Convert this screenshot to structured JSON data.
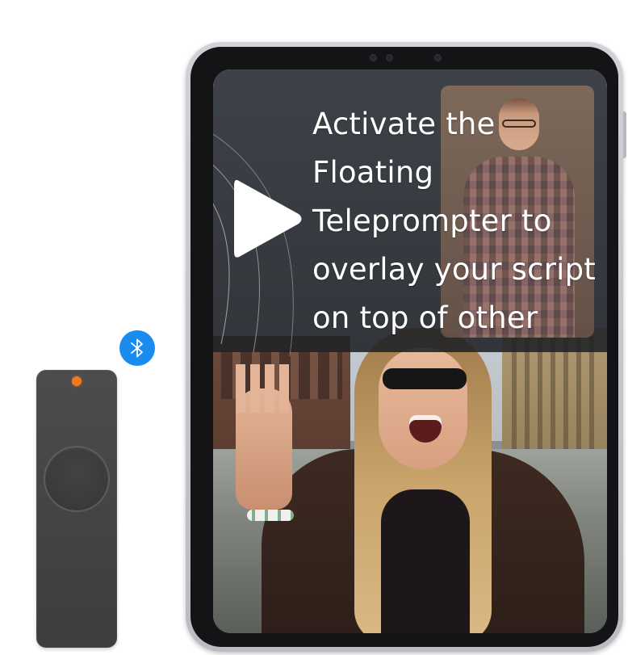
{
  "headline": {
    "text": "Activate the\nFloating\nTeleprompter to\noverlay your script\non top of other"
  },
  "icons": {
    "play": "play-icon",
    "bluetooth": "bluetooth-icon",
    "remote": "bluetooth-remote"
  },
  "colors": {
    "bluetooth_badge": "#1a8cf0",
    "remote_body": "#444446",
    "remote_led": "#f07a1c",
    "overlay": "#24282e",
    "headline_text": "#ffffff",
    "tablet_frame": "#c4c7cb"
  }
}
